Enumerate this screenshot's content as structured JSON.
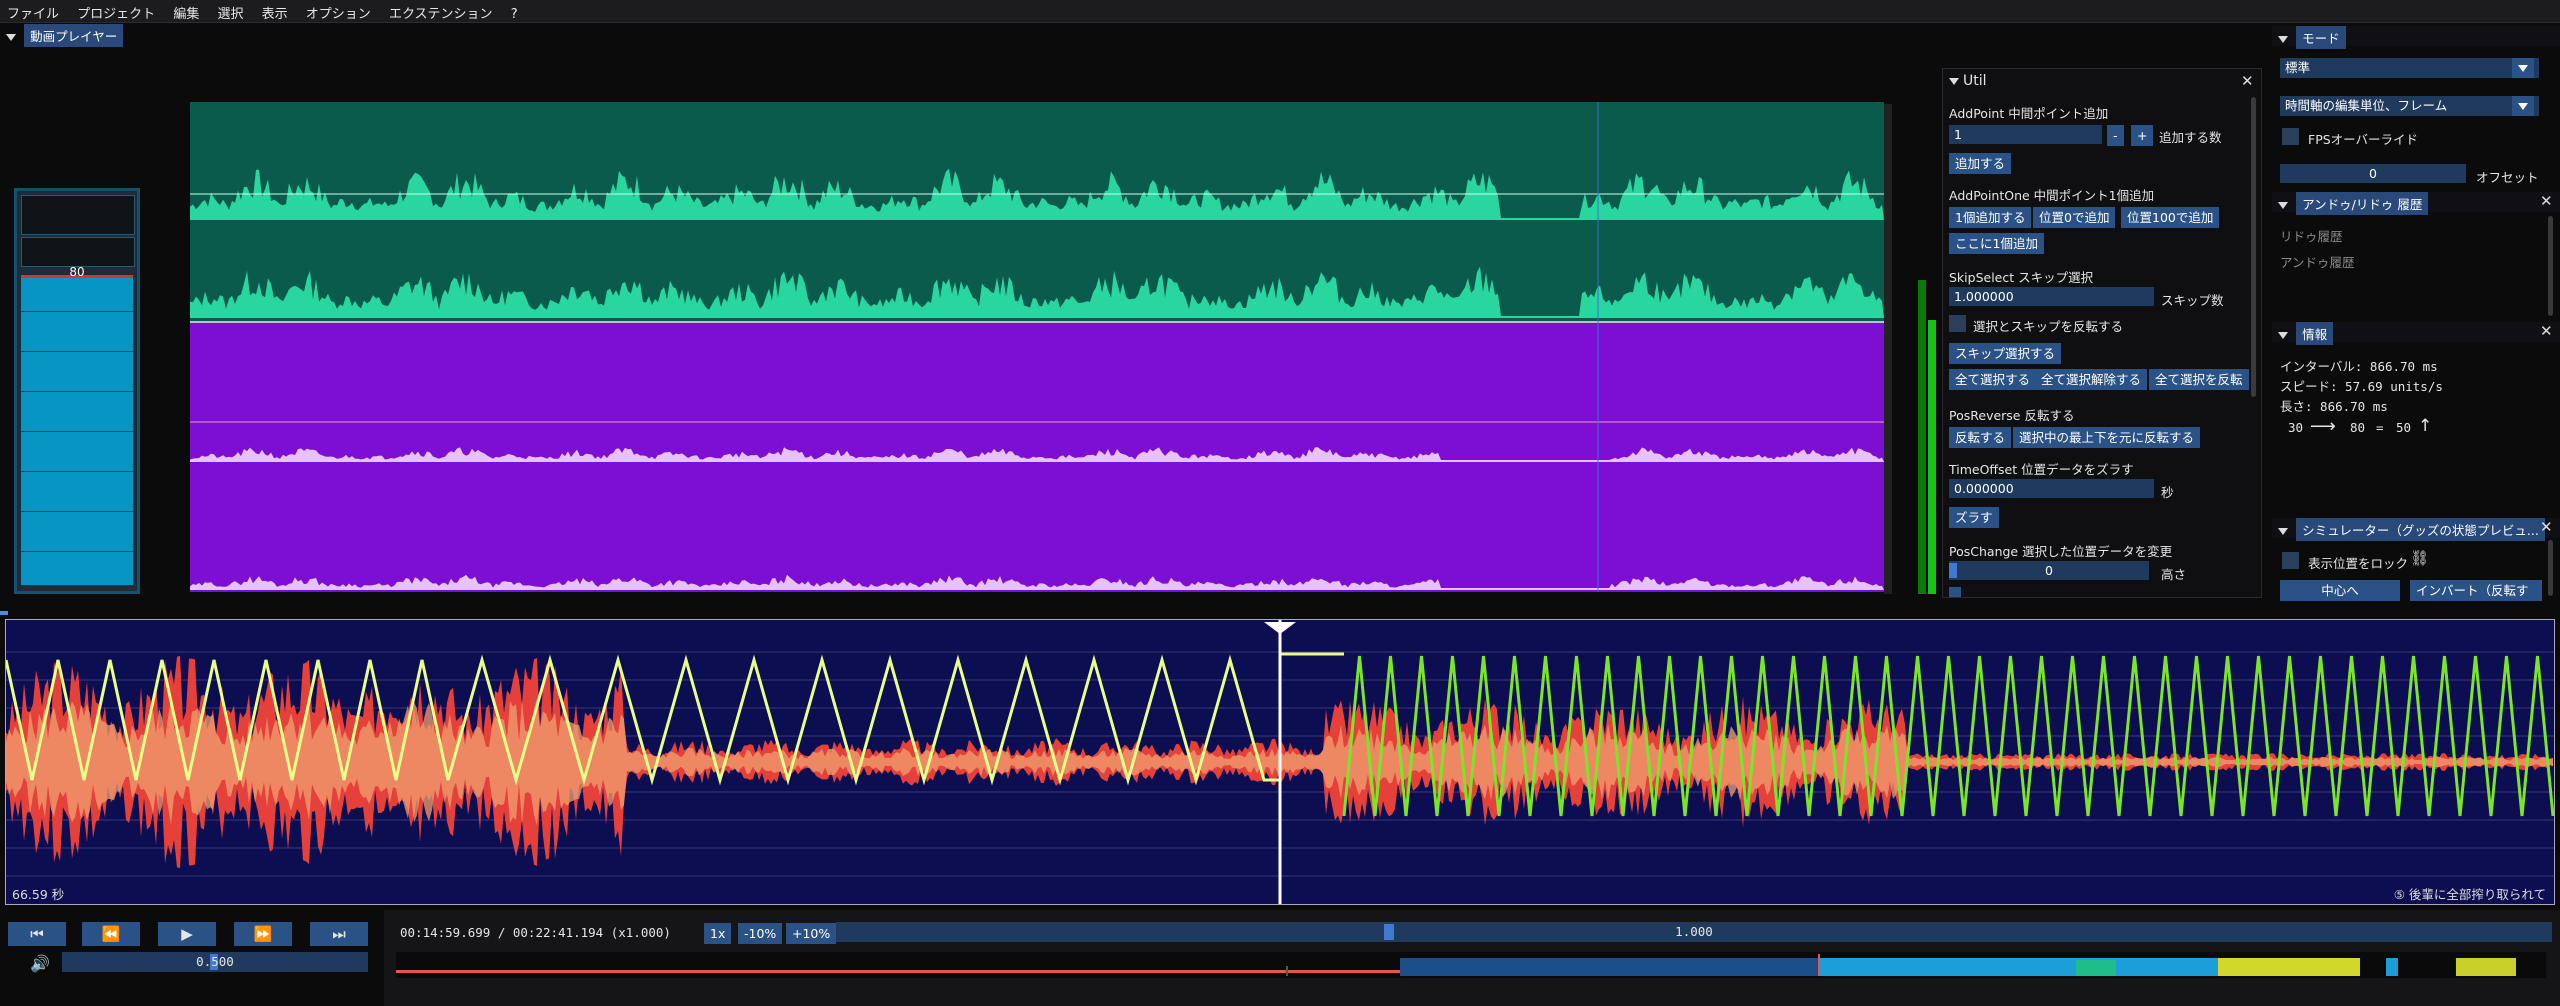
{
  "menu": [
    "ファイル",
    "プロジェクト",
    "編集",
    "選択",
    "表示",
    "オプション",
    "エクステンション",
    "?"
  ],
  "video_panel": {
    "title": "動画プレイヤー"
  },
  "meter": {
    "value": "80"
  },
  "util": {
    "title": "Util",
    "addpoint": {
      "title": "AddPoint 中間ポイント追加",
      "count_value": "1",
      "minus": "-",
      "plus": "+",
      "count_label": "追加する数",
      "add_button": "追加する"
    },
    "addpointone": {
      "title": "AddPointOne 中間ポイント1個追加",
      "b1": "1個追加する",
      "b2": "位置0で追加",
      "b3": "位置100で追加",
      "b4": "ここに1個追加"
    },
    "skipselect": {
      "title": "SkipSelect スキップ選択",
      "value": "1.000000",
      "value_label": "スキップ数",
      "invert_label": "選択とスキップを反転する",
      "b1": "スキップ選択する",
      "b2": "全て選択する",
      "b3": "全て選択解除する",
      "b4": "全て選択を反転"
    },
    "posreverse": {
      "title": "PosReverse 反転する",
      "b1": "反転する",
      "b2": "選択中の最上下を元に反転する"
    },
    "timeoffset": {
      "title": "TimeOffset 位置データをズラす",
      "value": "0.000000",
      "unit": "秒",
      "b1": "ズラす"
    },
    "poschange": {
      "title": "PosChange 選択した位置データを変更",
      "value": "0",
      "unit": "高さ"
    }
  },
  "mode_panel": {
    "title": "モード",
    "select1": "標準",
    "select2": "時間軸の編集単位、フレーム",
    "fps_label": "FPSオーバーライド",
    "offset_value": "0",
    "offset_label": "オフセット"
  },
  "undo_panel": {
    "title": "アンドゥ/リドゥ 履歴",
    "redo": "リドゥ履歴",
    "undo": "アンドゥ履歴"
  },
  "info_panel": {
    "title": "情報",
    "interval": "インターバル: 866.70 ms",
    "speed": "スピード: 57.69 units/s",
    "length": "長さ: 866.70 ms",
    "from": "30",
    "to": "80",
    "eq": "=",
    "diff": "50"
  },
  "sim_panel": {
    "title": "シミュレーター（グッズの状態プレビュ...",
    "lock_label": "表示位置をロック",
    "center": "中心へ",
    "invert": "インバート（反転す"
  },
  "timeline": {
    "left_label": "66.59 秒",
    "right_label": "⑤ 後輩に全部搾り取られて"
  },
  "transport": {
    "time": "00:14:59.699 / 00:22:41.194 (x1.000)",
    "speed_1x": "1x",
    "minus10": "-10%",
    "plus10": "+10%",
    "rate": "1.000",
    "volume": "0.500"
  },
  "colors": {
    "accent": "#2a5286",
    "teal": "#0b5b4d",
    "teal_wave": "#29d6a0",
    "purple": "#7d0fd4",
    "purple_wave": "#e7c2f6",
    "timeline_bg": "#0d0d52",
    "script_yellow": "#e8ff8a",
    "script_green": "#7be627",
    "audio_red": "#e6403a"
  }
}
